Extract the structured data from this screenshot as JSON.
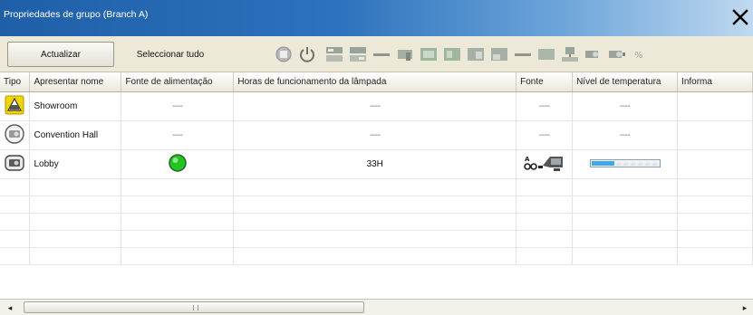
{
  "window": {
    "title": "Propriedades de grupo (Branch A)",
    "close_icon": "close-icon"
  },
  "toolbar": {
    "refresh_label": "Actualizar",
    "select_all_label": "Seleccionar tudo",
    "icons": [
      "stop-icon",
      "power-icon",
      "source-icon",
      "source-alt-icon",
      "dash-icon",
      "video-icon",
      "screen-icon",
      "screen-alt-icon",
      "window-icon",
      "window-alt-icon",
      "dash-alt-icon",
      "display-icon",
      "network-icon",
      "projector-icon",
      "projector-alt-icon",
      "more-icon"
    ]
  },
  "grid": {
    "columns": [
      "Tipo",
      "Apresentar nome",
      "Fonte de alimentação",
      "Horas de funcionamento da lâmpada",
      "Fonte",
      "Nível de temperatura",
      "Informa"
    ],
    "rows": [
      {
        "type_icon": "projector-warning-icon",
        "name": "Showroom",
        "power": "----",
        "lamp_hours": "----",
        "source": "----",
        "temperature": "----"
      },
      {
        "type_icon": "projector-idle-icon",
        "name": "Convention Hall",
        "power": "----",
        "lamp_hours": "----",
        "source": "----",
        "temperature": "----"
      },
      {
        "type_icon": "projector-active-icon",
        "name": "Lobby",
        "power_status": "on",
        "lamp_hours": "33H",
        "source_icon": "source-computer-icon",
        "temperature_level": 0.33
      }
    ],
    "empty_rows": 5
  },
  "colors": {
    "title_bar_start": "#1f5fa8",
    "title_bar_end": "#bfd9f0",
    "power_on": "#22c422",
    "warning": "#f2d400",
    "temperature_fill": "#3ea7e6"
  }
}
